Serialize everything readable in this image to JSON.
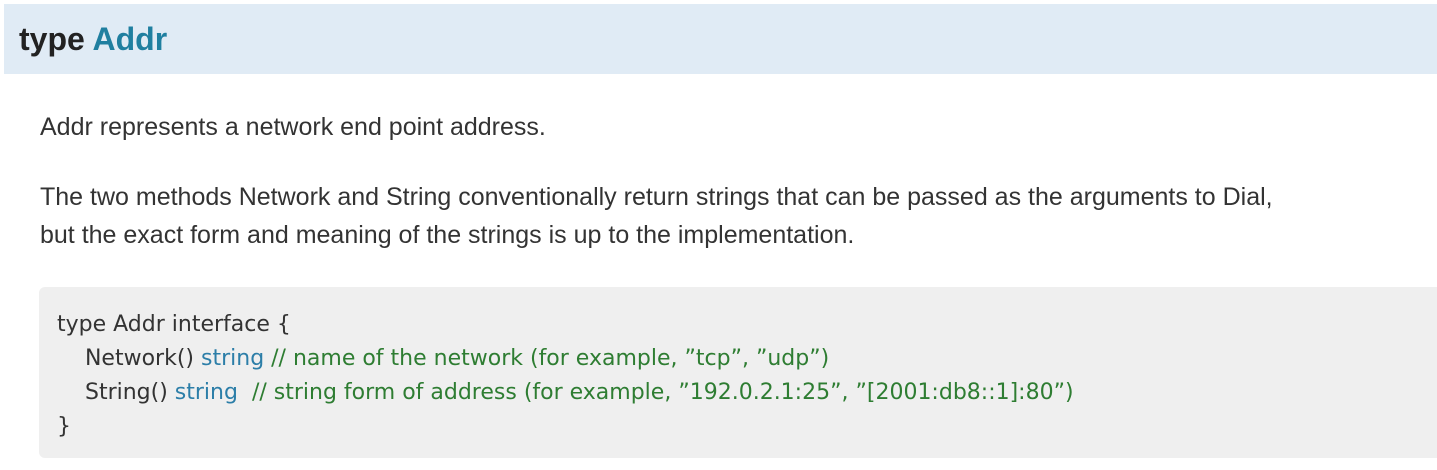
{
  "heading": {
    "keyword": "type",
    "name": "Addr"
  },
  "description": {
    "paragraph1": "Addr represents a network end point address.",
    "paragraph2_line1": "The two methods Network and String conventionally return strings that can be passed as the arguments to Dial,",
    "paragraph2_line2": "but the exact form and meaning of the strings is up to the implementation."
  },
  "code": {
    "line1": "type Addr interface {",
    "line2_method": "    Network() ",
    "line2_type": "string",
    "line2_comment": " // name of the network (for example, ”tcp”, ”udp”)",
    "line3_method": "    String() ",
    "line3_type": "string",
    "line3_comment": "  // string form of address (for example, ”192.0.2.1:25”, ”[2001:db8::1]:80”)",
    "line4": "}"
  },
  "colors": {
    "heading_bg": "#e0ebf5",
    "type_name": "#1f7fa0",
    "code_bg": "#efefef",
    "code_type": "#2c7ea8",
    "code_comment": "#2e7d32"
  }
}
